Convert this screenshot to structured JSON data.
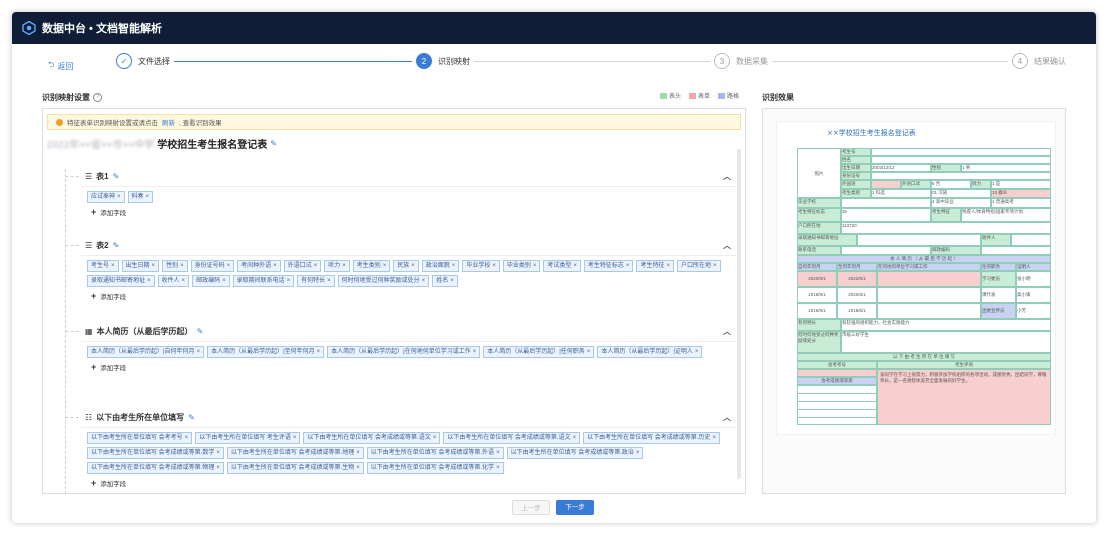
{
  "app": {
    "title": "数据中台 • 文档智能解析"
  },
  "nav": {
    "back_label": "返回"
  },
  "steps": [
    {
      "num": "✓",
      "label": "文件选择",
      "state": "done"
    },
    {
      "num": "2",
      "label": "识别映射",
      "state": "active"
    },
    {
      "num": "3",
      "label": "数据采集",
      "state": "pending"
    },
    {
      "num": "4",
      "label": "结果确认",
      "state": "pending"
    }
  ],
  "left": {
    "title": "识别映射设置",
    "help_icon": "question-icon",
    "legend": [
      {
        "label": "表头",
        "color": "#9fdcb3"
      },
      {
        "label": "表单",
        "color": "#f3a6a6"
      },
      {
        "label": "路格",
        "color": "#aab6ea"
      }
    ],
    "notice": {
      "text_before": "特征表单识别映射设置或请点击",
      "link": "刷新",
      "text_after": ", 查看识别效果"
    },
    "form_title_blurred": "2022年××省××市××中学",
    "form_title": "学校招生考生报名登记表",
    "groups": [
      {
        "label": "表1",
        "tags": [
          "应试奉神",
          "科奏"
        ]
      },
      {
        "label": "表2",
        "tags": [
          "考生号",
          "出生日期",
          "性别",
          "身份证号码",
          "考间种外语",
          "外语口试",
          "听力",
          "考生类别",
          "民族",
          "政治面貌",
          "毕业学校",
          "毕业类别",
          "考试类型",
          "考生特征标志",
          "考生特征",
          "户口所在地",
          "录取通知书邮寄地址",
          "收件人",
          "邮政编码",
          "录取期间联系电话",
          "有何特长",
          "何时何地受过何种奖励或处分",
          "姓名"
        ]
      },
      {
        "label": "本人简历（从最后学历起）",
        "tags": [
          "本人简历（从最后学历起）|自何年何月",
          "本人简历（从最后学历起）|至何年何月",
          "本人简历（从最后学历起）|在何地何单位学习或工作",
          "本人简历（从最后学历起）|任何职务",
          "本人简历（从最后学历起）|证明人"
        ]
      },
      {
        "label": "以下由考生所在单位填写",
        "tags": [
          "以下由考生所在单位填写 会考考号",
          "以下由考生所在单位填写 考生评语",
          "以下由考生所在单位填写 会考成绩或等第.语文",
          "以下由考生所在单位填写 会考成绩或等第.语文",
          "以下由考生所在单位填写 会考成绩或等第.历史",
          "以下由考生所在单位填写 会考成绩或等第.数学",
          "以下由考生所在单位填写 会考成绩或等第.地理",
          "以下由考生所在单位填写 会考成绩或等第.外语",
          "以下由考生所在单位填写 会考成绩或等第.政治",
          "以下由考生所在单位填写 会考成绩或等第.物理",
          "以下由考生所在单位填写 会考成绩或等第.生物",
          "以下由考生所在单位填写 会考成绩或等第.化学"
        ]
      }
    ],
    "add_field_label": "添加字段"
  },
  "right": {
    "title": "识别效果",
    "doc_title": "××学校招生考生报名登记表",
    "doc_cells": {
      "photo": "照片",
      "exam_no": "考生号",
      "name": "姓名",
      "birth": "出生日期",
      "birth_val": "2003/12/12",
      "gender": "性别",
      "gender_val": "1 男",
      "id_no": "身份证号",
      "foreign": "外国语",
      "oral": "外语口试",
      "oral_val": "6 否",
      "listening": "听力",
      "listening_val": "1 是",
      "category": "考生类别",
      "category_val": "1 科选",
      "ethnic_val": "01 汉族",
      "politics_val": "13 群众",
      "school": "毕业学校",
      "school_type_val": "4 高中毕业",
      "exam_type_val": "1 普通高考",
      "feature": "考生特征标志",
      "feature_val": "30",
      "feature2": "考生特征",
      "feature2_val": "残疾人/体育特招/国家专项计划",
      "hukou": "户口所在地",
      "hukou_val": "113720",
      "address": "录取通知书邮寄地址",
      "receiver": "收件人",
      "phone": "联系电话",
      "zip": "邮政编码",
      "resume_header": "本 人 简 历 （ 从 最 后 学 历 起 ）",
      "col_from": "自何年何月",
      "col_to": "至何年何月",
      "col_where": "在何地何单位学习或工作",
      "col_duty": "任何职务",
      "col_witness": "证明人",
      "r1_from": "2020/9/1",
      "r1_to": "2022/6/1",
      "r1_duty": "学习委员",
      "r1_witness": "张小明",
      "r2_from": "2018/9/1",
      "r2_to": "2020/6/1",
      "r2_duty": "课代表",
      "r2_witness": "高小锋",
      "r3_from": "2016/9/1",
      "r3_to": "2018/6/1",
      "r3_duty": "团委宣传员",
      "r3_witness": "小芳",
      "specialty": "有何特长",
      "specialty_val": "有较强的组织能力，社会实践能力",
      "award": "何时何地受过何种奖励或处分",
      "award_val": "市级三好学生",
      "unit_header": "以 下 由 考 生 所 在 单 位 填 写",
      "exam_code": "会考考号",
      "comment": "考生评语",
      "score_title": "会考成绩或等第",
      "comment_val": "该同学在学习上很努力，积极参加学校组织的各项活动，成绩优秀，团结同学，尊敬师长，是一名德智体美劳全面发展的好学生。"
    }
  },
  "footer": {
    "prev_label": "上一步",
    "next_label": "下一步"
  }
}
